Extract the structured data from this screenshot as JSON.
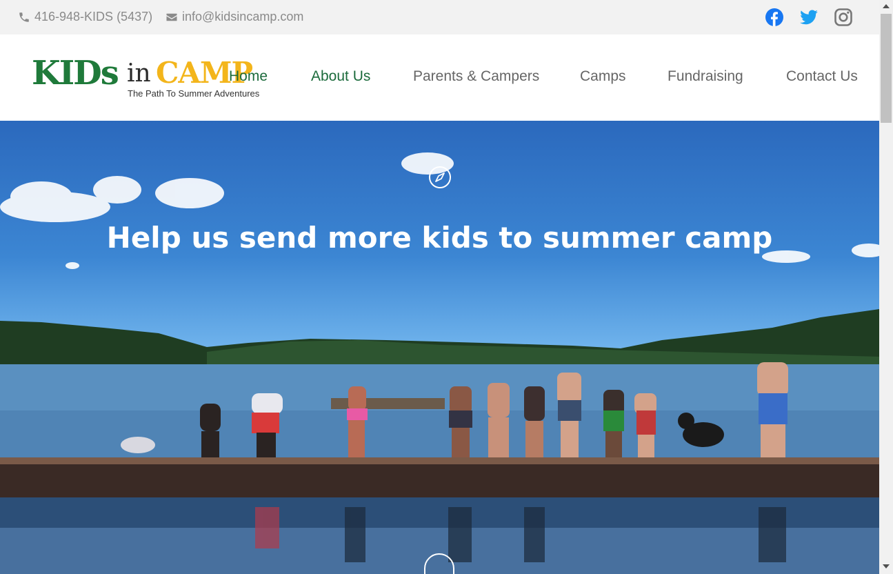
{
  "topbar": {
    "phone": "416-948-KIDS (5437)",
    "email": "info@kidsincamp.com",
    "phone_icon": "phone-icon",
    "email_icon": "envelope-icon",
    "social": [
      "facebook-icon",
      "twitter-icon",
      "instagram-icon"
    ]
  },
  "logo": {
    "brand_kids": "KIDs",
    "brand_in": "in",
    "brand_camp": "CAMP",
    "tagline": "The Path To Summer Adventures"
  },
  "nav": {
    "items": [
      "Home",
      "About Us",
      "Parents & Campers",
      "Camps",
      "Fundraising",
      "Contact Us"
    ],
    "active": "About Us"
  },
  "hero": {
    "title": "Help us send more kids to summer camp",
    "icon": "compass-icon"
  },
  "colors": {
    "brand_green": "#1c6b3c",
    "brand_yellow": "#f3b51b",
    "facebook": "#1877f2",
    "twitter": "#1da1f2",
    "instagram": "#777777"
  }
}
